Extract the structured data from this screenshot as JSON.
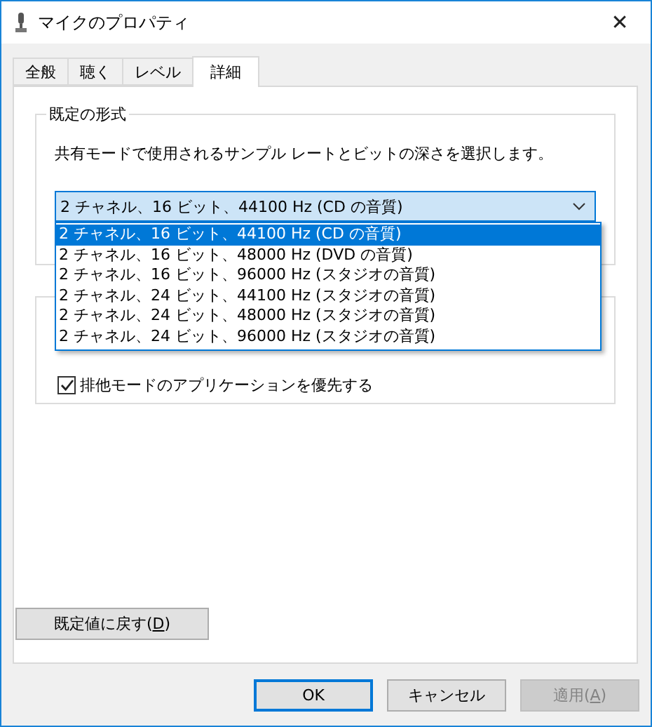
{
  "window": {
    "title": "マイクのプロパティ",
    "close": "✕"
  },
  "tabs": [
    {
      "label": "全般",
      "selected": false
    },
    {
      "label": "聴く",
      "selected": false
    },
    {
      "label": "レベル",
      "selected": false
    },
    {
      "label": "詳細",
      "selected": true
    }
  ],
  "default_format": {
    "title": "既定の形式",
    "description": "共有モードで使用されるサンプル レートとビットの深さを選択します。",
    "value": "2 チャネル、16 ビット、44100 Hz (CD の音質)",
    "expanded": true,
    "options": [
      {
        "label": "2 チャネル、16 ビット、44100 Hz (CD の音質)",
        "selected": true
      },
      {
        "label": "2 チャネル、16 ビット、48000 Hz (DVD の音質)",
        "selected": false
      },
      {
        "label": "2 チャネル、16 ビット、96000 Hz (スタジオの音質)",
        "selected": false
      },
      {
        "label": "2 チャネル、24 ビット、44100 Hz (スタジオの音質)",
        "selected": false
      },
      {
        "label": "2 チャネル、24 ビット、48000 Hz (スタジオの音質)",
        "selected": false
      },
      {
        "label": "2 チャネル、24 ビット、96000 Hz (スタジオの音質)",
        "selected": false
      }
    ]
  },
  "exclusive_mode": {
    "checkbox": {
      "label": "排他モードのアプリケーションを優先する",
      "checked": true
    }
  },
  "reset_button": {
    "before": "既定値に戻す(",
    "accelerator": "D",
    "after": ")"
  },
  "buttons": [
    {
      "before": "OK",
      "default": true,
      "disabled": false
    },
    {
      "before": "キャンセル",
      "default": false,
      "disabled": false
    },
    {
      "before": "適用(",
      "accelerator": "A",
      "after": ")",
      "default": false,
      "disabled": true
    }
  ]
}
